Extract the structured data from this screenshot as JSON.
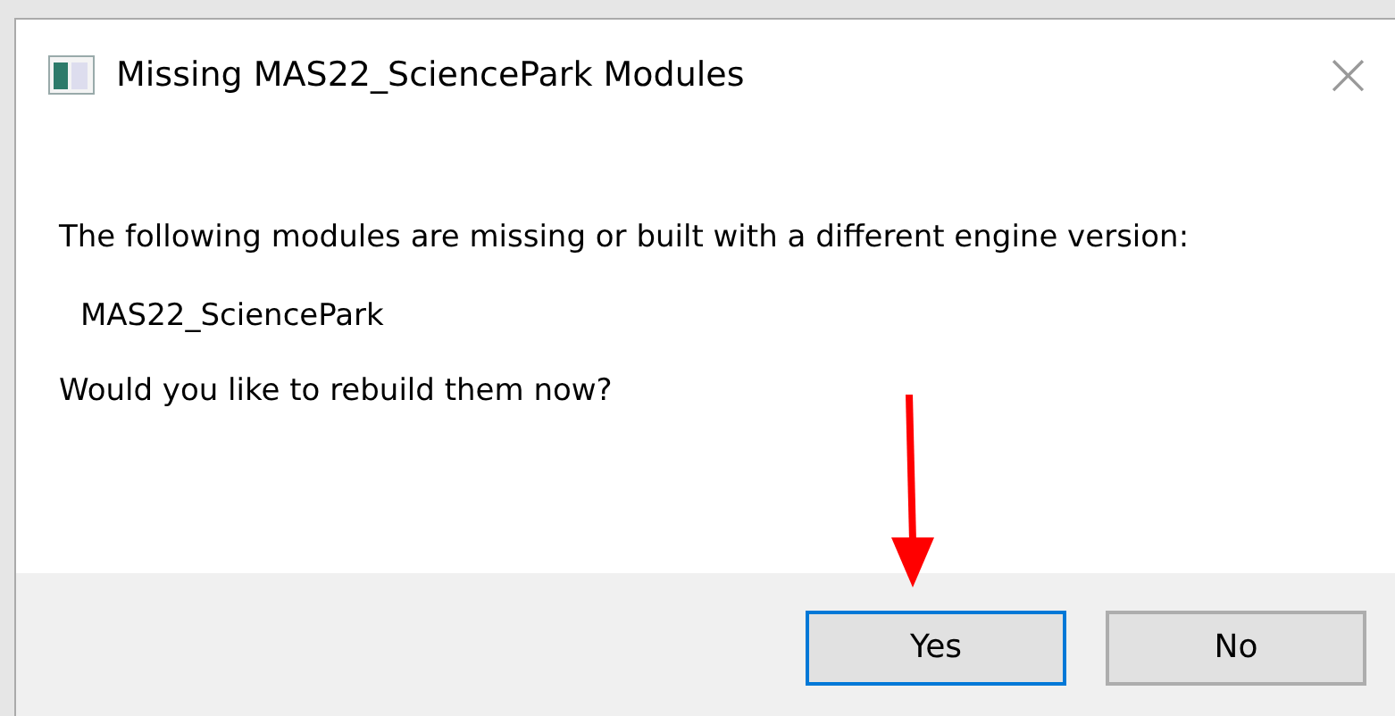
{
  "window": {
    "title": "Missing MAS22_SciencePark Modules",
    "close": "×"
  },
  "message": "The following modules are missing or built with a different engine version:",
  "modules": [
    "MAS22_SciencePark"
  ],
  "question": "Would you like to rebuild them now?",
  "buttons": [
    {
      "label": "Yes",
      "default": true
    },
    {
      "label": "No",
      "default": false
    }
  ]
}
